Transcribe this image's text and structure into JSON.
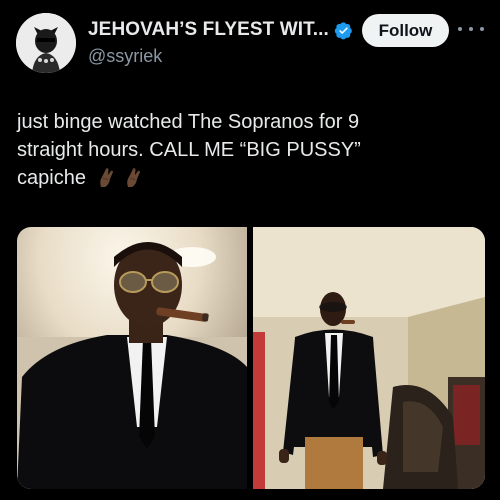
{
  "post": {
    "author": {
      "display_name": "JEHOVAH’S FLYEST WIT...",
      "handle": "@ssyriek",
      "verified": true,
      "verified_icon": "verified-badge-icon",
      "avatar_icon": "avatar-horned-figure"
    },
    "follow_label": "Follow",
    "more_icon": "more-options-icon",
    "text_lines": [
      "just binge watched The Sopranos for 9",
      "straight hours. CALL ME “BIG PUSSY”",
      "capiche"
    ],
    "emojis": [
      "pinched-fingers-emoji",
      "pinched-fingers-emoji"
    ],
    "media": [
      {
        "name": "photo-selfie-suit-cigar"
      },
      {
        "name": "photo-full-body-suit-mirror"
      }
    ]
  },
  "colors": {
    "background": "#000000",
    "text": "#e7e9ea",
    "muted": "#8b98a5",
    "verified": "#1d9bf0",
    "follow_bg": "#eff3f4"
  }
}
